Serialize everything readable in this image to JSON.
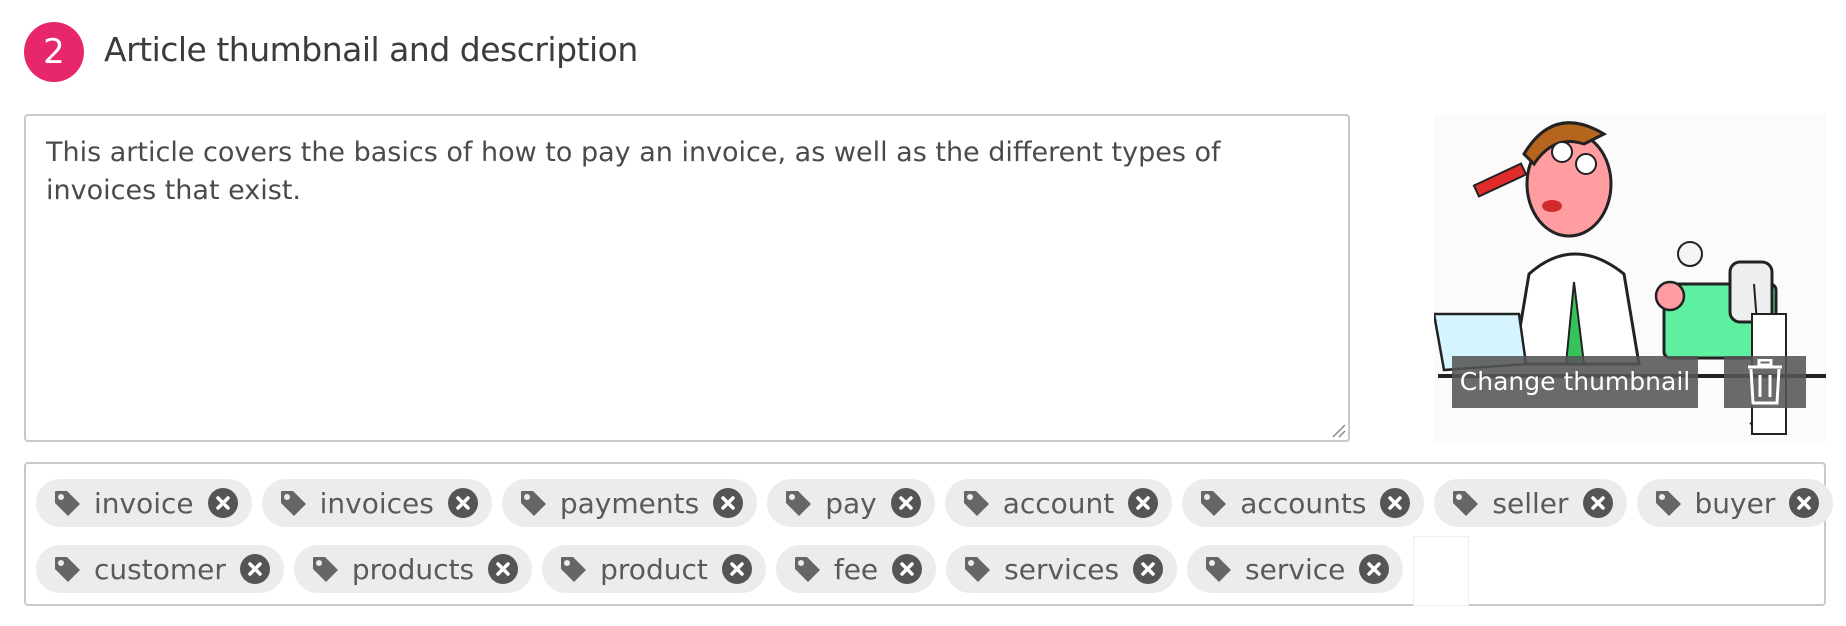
{
  "section": {
    "step_number": "2",
    "title": "Article thumbnail and description"
  },
  "description": {
    "value": "This article covers the basics of how to pay an invoice, as well as the different types of invoices that exist."
  },
  "thumbnail": {
    "change_label": "Change thumbnail",
    "delete_icon": "trash-icon",
    "image_alt": "cartoon-man-with-calculator"
  },
  "tags": {
    "row1": [
      "invoice",
      "invoices",
      "payments",
      "pay",
      "account",
      "accounts",
      "seller",
      "buyer"
    ],
    "row2": [
      "customer",
      "products",
      "product",
      "fee",
      "services",
      "service"
    ],
    "tag_icon": "tag-icon",
    "remove_icon": "close-circle-icon"
  },
  "colors": {
    "accent": "#e8266b",
    "tag_bg": "#ececec",
    "remove_bg": "#555555"
  }
}
